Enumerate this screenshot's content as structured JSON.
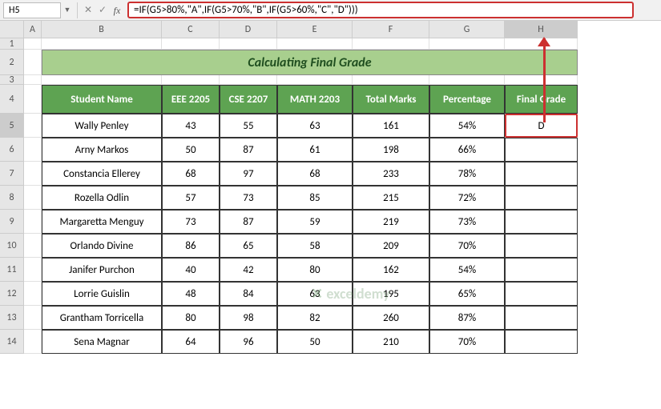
{
  "nameBox": "H5",
  "formula": "=IF(G5>80%,\"A\",IF(G5>70%,\"B\",IF(G5>60%,\"C\",\"D\")))",
  "columns": [
    "A",
    "B",
    "C",
    "D",
    "E",
    "F",
    "G",
    "H"
  ],
  "rows": [
    "1",
    "2",
    "3",
    "4",
    "5",
    "6",
    "7",
    "8",
    "9",
    "10",
    "11",
    "12",
    "13",
    "14"
  ],
  "title": "Calculating Final Grade",
  "headers": {
    "b": "Student Name",
    "c": "EEE 2205",
    "d": "CSE 2207",
    "e": "MATH 2203",
    "f": "Total Marks",
    "g": "Percentage",
    "h": "Final Grade"
  },
  "data": [
    {
      "name": "Wally Penley",
      "c": "43",
      "d": "55",
      "e": "63",
      "f": "161",
      "g": "54%",
      "h": "D"
    },
    {
      "name": "Arny Markos",
      "c": "50",
      "d": "87",
      "e": "61",
      "f": "198",
      "g": "66%",
      "h": ""
    },
    {
      "name": "Constancia Ellerey",
      "c": "68",
      "d": "97",
      "e": "68",
      "f": "233",
      "g": "78%",
      "h": ""
    },
    {
      "name": "Rozella Odlin",
      "c": "57",
      "d": "73",
      "e": "85",
      "f": "215",
      "g": "72%",
      "h": ""
    },
    {
      "name": "Margaretta Menguy",
      "c": "73",
      "d": "87",
      "e": "59",
      "f": "219",
      "g": "73%",
      "h": ""
    },
    {
      "name": "Orlando Divine",
      "c": "86",
      "d": "65",
      "e": "58",
      "f": "209",
      "g": "70%",
      "h": ""
    },
    {
      "name": "Janifer Purchon",
      "c": "40",
      "d": "42",
      "e": "80",
      "f": "162",
      "g": "54%",
      "h": ""
    },
    {
      "name": "Lorrie Guislin",
      "c": "48",
      "d": "84",
      "e": "63",
      "f": "195",
      "g": "65%",
      "h": ""
    },
    {
      "name": "Grantham Torricella",
      "c": "80",
      "d": "98",
      "e": "82",
      "f": "260",
      "g": "87%",
      "h": ""
    },
    {
      "name": "Sena Magnar",
      "c": "64",
      "d": "96",
      "e": "50",
      "f": "210",
      "g": "70%",
      "h": ""
    }
  ],
  "watermark": "exceldemy",
  "chart_data": {
    "type": "table",
    "title": "Calculating Final Grade",
    "columns": [
      "Student Name",
      "EEE 2205",
      "CSE 2207",
      "MATH 2203",
      "Total Marks",
      "Percentage",
      "Final Grade"
    ],
    "rows": [
      [
        "Wally Penley",
        43,
        55,
        63,
        161,
        "54%",
        "D"
      ],
      [
        "Arny Markos",
        50,
        87,
        61,
        198,
        "66%",
        ""
      ],
      [
        "Constancia Ellerey",
        68,
        97,
        68,
        233,
        "78%",
        ""
      ],
      [
        "Rozella Odlin",
        57,
        73,
        85,
        215,
        "72%",
        ""
      ],
      [
        "Margaretta Menguy",
        73,
        87,
        59,
        219,
        "73%",
        ""
      ],
      [
        "Orlando Divine",
        86,
        65,
        58,
        209,
        "70%",
        ""
      ],
      [
        "Janifer Purchon",
        40,
        42,
        80,
        162,
        "54%",
        ""
      ],
      [
        "Lorrie Guislin",
        48,
        84,
        63,
        195,
        "65%",
        ""
      ],
      [
        "Grantham Torricella",
        80,
        98,
        82,
        260,
        "87%",
        ""
      ],
      [
        "Sena Magnar",
        64,
        96,
        50,
        210,
        "70%",
        ""
      ]
    ]
  }
}
